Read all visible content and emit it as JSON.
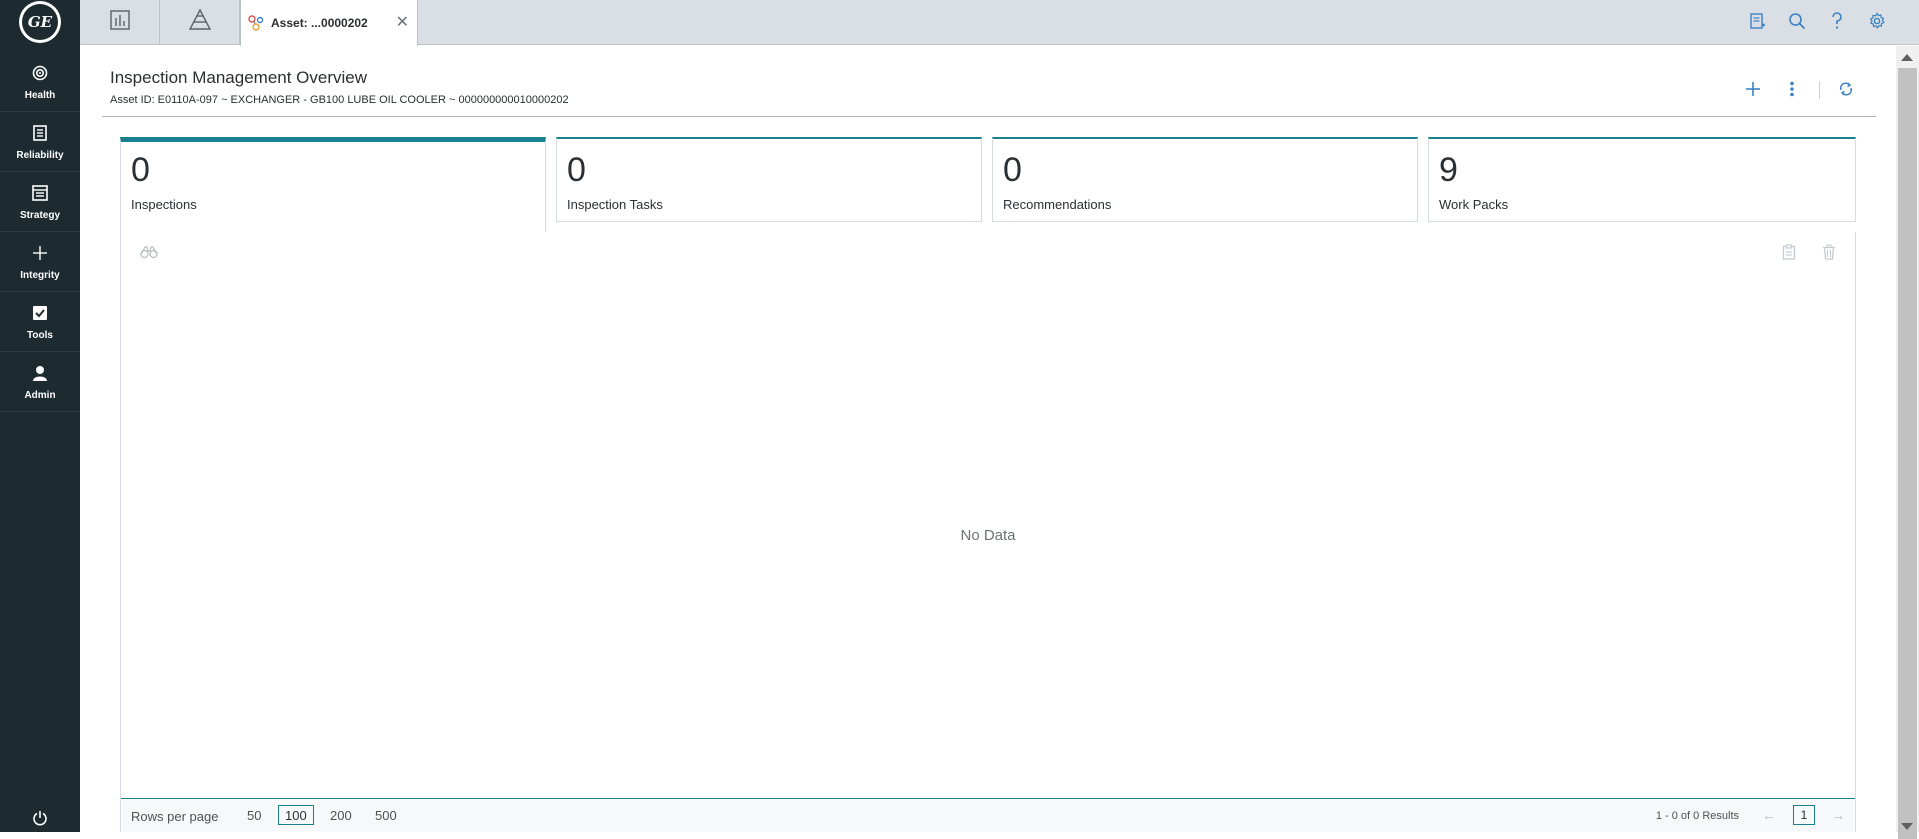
{
  "nav": {
    "items": [
      {
        "label": "Health",
        "icon": "target-icon"
      },
      {
        "label": "Reliability",
        "icon": "document-icon"
      },
      {
        "label": "Strategy",
        "icon": "list-icon"
      },
      {
        "label": "Integrity",
        "icon": "plus-icon"
      },
      {
        "label": "Tools",
        "icon": "checkbox-icon"
      },
      {
        "label": "Admin",
        "icon": "user-icon"
      }
    ],
    "logo_text": "GE"
  },
  "tabs": {
    "active_label": "Asset: ...0000202",
    "close_glyph": "✕"
  },
  "header": {
    "title": "Inspection Management Overview",
    "subtitle": "Asset ID: E0110A-097 ~ EXCHANGER - GB100 LUBE OIL COOLER ~ 000000000010000202"
  },
  "cards": [
    {
      "value": "0",
      "label": "Inspections"
    },
    {
      "value": "0",
      "label": "Inspection Tasks"
    },
    {
      "value": "0",
      "label": "Recommendations"
    },
    {
      "value": "9",
      "label": "Work Packs"
    }
  ],
  "grid": {
    "empty_text": "No Data"
  },
  "pager": {
    "rows_label": "Rows per page",
    "options": [
      "50",
      "100",
      "200",
      "500"
    ],
    "selected": "100",
    "results_text": "1 - 0 of 0 Results",
    "page": "1"
  },
  "colors": {
    "accent": "#1a7f8f",
    "nav_bg": "#1d2a2f",
    "action_blue": "#3b82c4"
  }
}
